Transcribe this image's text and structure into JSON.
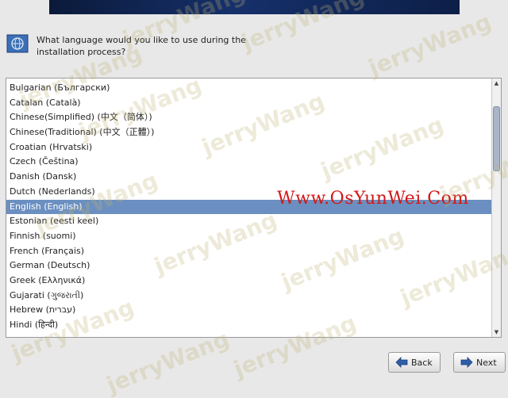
{
  "header": {
    "question_line1": "What language would you like to use during the",
    "question_line2": "installation process?"
  },
  "languages": [
    "Bulgarian (Български)",
    "Catalan (Català)",
    "Chinese(Simplified) (中文（简体）)",
    "Chinese(Traditional) (中文（正體）)",
    "Croatian (Hrvatski)",
    "Czech (Čeština)",
    "Danish (Dansk)",
    "Dutch (Nederlands)",
    "English (English)",
    "Estonian (eesti keel)",
    "Finnish (suomi)",
    "French (Français)",
    "German (Deutsch)",
    "Greek (Ελληνικά)",
    "Gujarati (ગુજરાતી)",
    "Hebrew (עברית)",
    "Hindi (हिन्दी)"
  ],
  "selected_language": "English (English)",
  "buttons": {
    "back": "Back",
    "next": "Next"
  },
  "watermarks": {
    "author": "jerryWang",
    "site": "Www.OsYunWei.Com"
  },
  "colors": {
    "selection": "#6b8fc0",
    "site_mark": "#d41818",
    "arrow_icon": "#2d5fa8"
  }
}
